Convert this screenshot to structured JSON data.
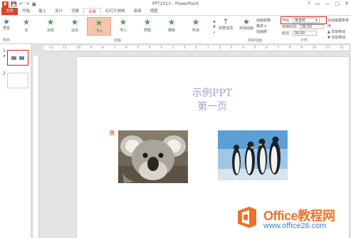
{
  "window": {
    "title": "PPT2013 - PowerPoint"
  },
  "quick_access": {
    "logo": "P",
    "icons": [
      "save-icon",
      "undo-icon",
      "redo-icon",
      "present-icon"
    ],
    "save": "💾",
    "undo": "↶",
    "redo": "↷",
    "present": "▣"
  },
  "window_controls": {
    "help": "?",
    "restore": "▭",
    "minimize": "—",
    "maximize": "□",
    "close": "✕"
  },
  "tabs": [
    "文件",
    "开始",
    "插入",
    "设计",
    "切换",
    "动画",
    "幻灯片放映",
    "审阅",
    "视图"
  ],
  "active_tab": "动画",
  "ribbon": {
    "preview_label": "预览",
    "preview_group_label": "预览",
    "animation_group_label": "动画",
    "advanced_group_label": "高级动画",
    "timing_group_label": "计时",
    "animations": [
      {
        "label": "无",
        "icon": "star-icon",
        "color": "gray"
      },
      {
        "label": "出现",
        "icon": "star-icon",
        "color": "green"
      },
      {
        "label": "淡出",
        "icon": "star-icon",
        "color": "green"
      },
      {
        "label": "飞入",
        "icon": "star-icon",
        "color": "green",
        "selected": true
      },
      {
        "label": "浮入",
        "icon": "star-icon",
        "color": "green"
      },
      {
        "label": "劈裂",
        "icon": "star-icon",
        "color": "green"
      },
      {
        "label": "擦除",
        "icon": "star-icon",
        "color": "green"
      },
      {
        "label": "形状",
        "icon": "star-icon",
        "color": "green"
      }
    ],
    "gallery_scroll": {
      "up": "▲",
      "down": "▼",
      "more": "▾"
    },
    "effect_options_label": "效果选项",
    "effect_options_arrow": "↑",
    "add_animation_label": "添加动画",
    "add_animation_icon": "★",
    "advanced_items": [
      "动画窗格",
      "触发 ▾",
      "动画刷"
    ],
    "timing": {
      "start_label": "开始:",
      "start_value": "单击时",
      "start_caret": "▾",
      "duration_label": "持续时间:",
      "duration_value": "00.50",
      "delay_label": "延迟:",
      "delay_value": "00.00",
      "spin": "▴▾"
    },
    "reorder": {
      "title": "对动画重新排序",
      "earlier": "▲ 向前移动",
      "later": "▼ 向后移动"
    }
  },
  "thumbnails": [
    {
      "number": "1",
      "star": "★",
      "selected": true
    },
    {
      "number": "2",
      "star": "",
      "selected": false
    }
  ],
  "ruler_ticks": [
    "12",
    "11",
    "10",
    "9",
    "8",
    "7",
    "6",
    "5",
    "4",
    "3",
    "2",
    "1",
    "0",
    "1",
    "2",
    "3",
    "4",
    "5",
    "6",
    "7",
    "8",
    "9",
    "10",
    "11",
    "12"
  ],
  "slide": {
    "title_line1": "示例PPT",
    "title_line2": "第一页",
    "animation_tag": "1"
  },
  "watermark": {
    "text": "Office教程网",
    "url": "www.office26.com"
  },
  "colors": {
    "accent": "#d24726",
    "title_text": "#a99ad6",
    "highlight_box": "#d21f1f",
    "selected_anim": "#f4c6b0"
  }
}
